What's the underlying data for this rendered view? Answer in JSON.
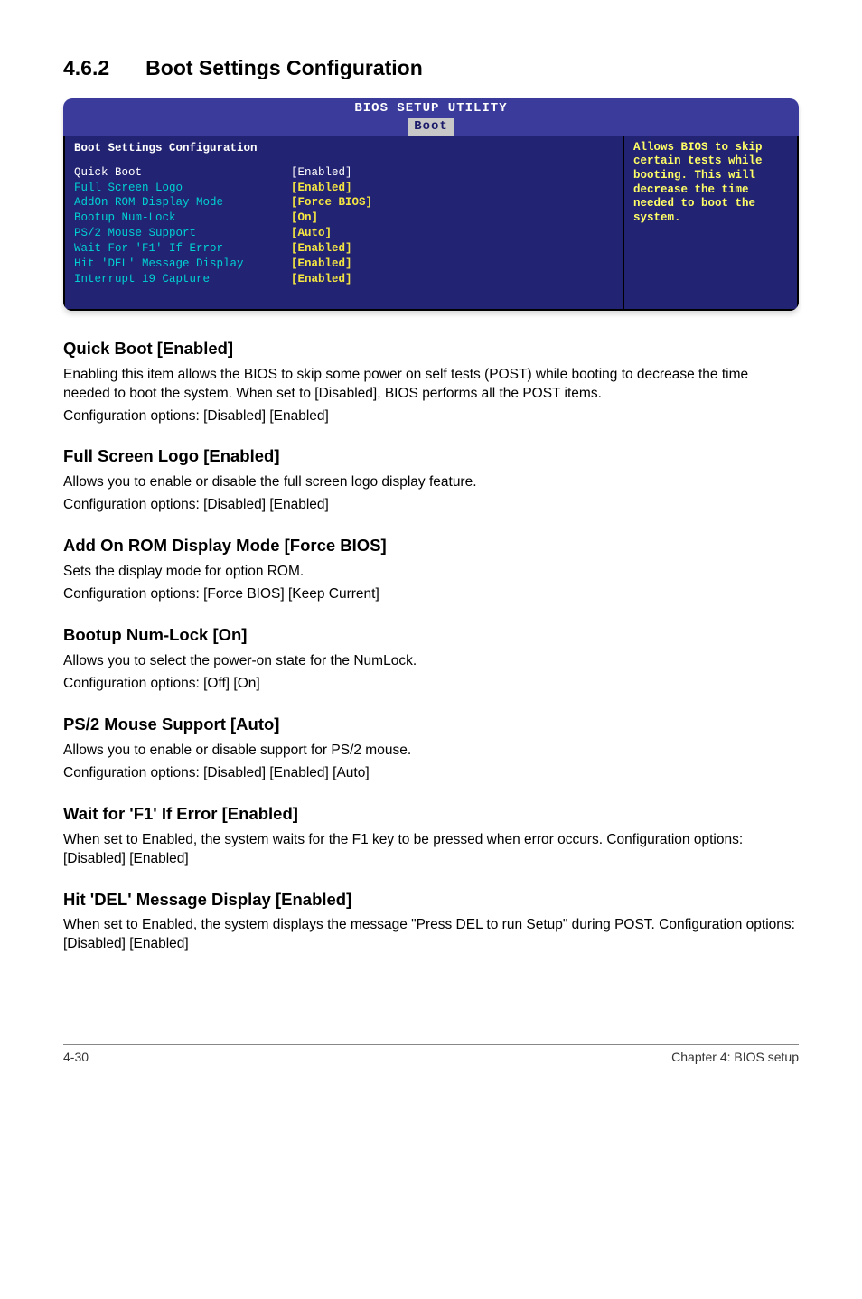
{
  "section": {
    "number": "4.6.2",
    "title": "Boot Settings Configuration"
  },
  "bios": {
    "header_title": "BIOS SETUP UTILITY",
    "tab": "Boot",
    "panel_title": "Boot Settings Configuration",
    "rows": [
      {
        "label": "Quick Boot",
        "value": "[Enabled]",
        "highlight": true
      },
      {
        "label": "Full Screen Logo",
        "value": "[Enabled]"
      },
      {
        "label": "AddOn ROM Display Mode",
        "value": "[Force BIOS]"
      },
      {
        "label": "Bootup Num-Lock",
        "value": "[On]"
      },
      {
        "label": "PS/2 Mouse Support",
        "value": "[Auto]"
      },
      {
        "label": "Wait For 'F1' If Error",
        "value": "[Enabled]"
      },
      {
        "label": "Hit 'DEL' Message Display",
        "value": "[Enabled]"
      },
      {
        "label": "Interrupt 19 Capture",
        "value": "[Enabled]"
      }
    ],
    "help": "Allows BIOS to skip certain tests while booting. This will decrease the time needed to boot the system."
  },
  "items": [
    {
      "heading": "Quick Boot [Enabled]",
      "text": "Enabling this item allows the BIOS to skip some power on self tests (POST) while booting to decrease the time needed to boot the system. When set to [Disabled], BIOS performs all the POST items.",
      "config": "Configuration options: [Disabled] [Enabled]"
    },
    {
      "heading": "Full Screen Logo [Enabled]",
      "text": "Allows you to enable or disable the full screen logo display feature.",
      "config": "Configuration options: [Disabled] [Enabled]"
    },
    {
      "heading": "Add On ROM Display Mode [Force BIOS]",
      "text": "Sets the display mode for option ROM.",
      "config": "Configuration options: [Force BIOS] [Keep Current]"
    },
    {
      "heading": "Bootup Num-Lock [On]",
      "text": "Allows you to select the power-on state for the NumLock.",
      "config": "Configuration options: [Off] [On]"
    },
    {
      "heading": "PS/2 Mouse Support [Auto]",
      "text": "Allows you to enable or disable support for PS/2 mouse.",
      "config": "Configuration options: [Disabled] [Enabled] [Auto]"
    },
    {
      "heading": "Wait for 'F1' If Error [Enabled]",
      "text": "When set to Enabled, the system waits for the F1 key to be pressed when error occurs. Configuration options: [Disabled] [Enabled]",
      "config": ""
    },
    {
      "heading": "Hit 'DEL' Message Display [Enabled]",
      "text": "When set to Enabled, the system displays the message \"Press DEL to run Setup\" during POST. Configuration options: [Disabled] [Enabled]",
      "config": ""
    }
  ],
  "footer": {
    "left": "4-30",
    "right": "Chapter 4: BIOS setup"
  }
}
